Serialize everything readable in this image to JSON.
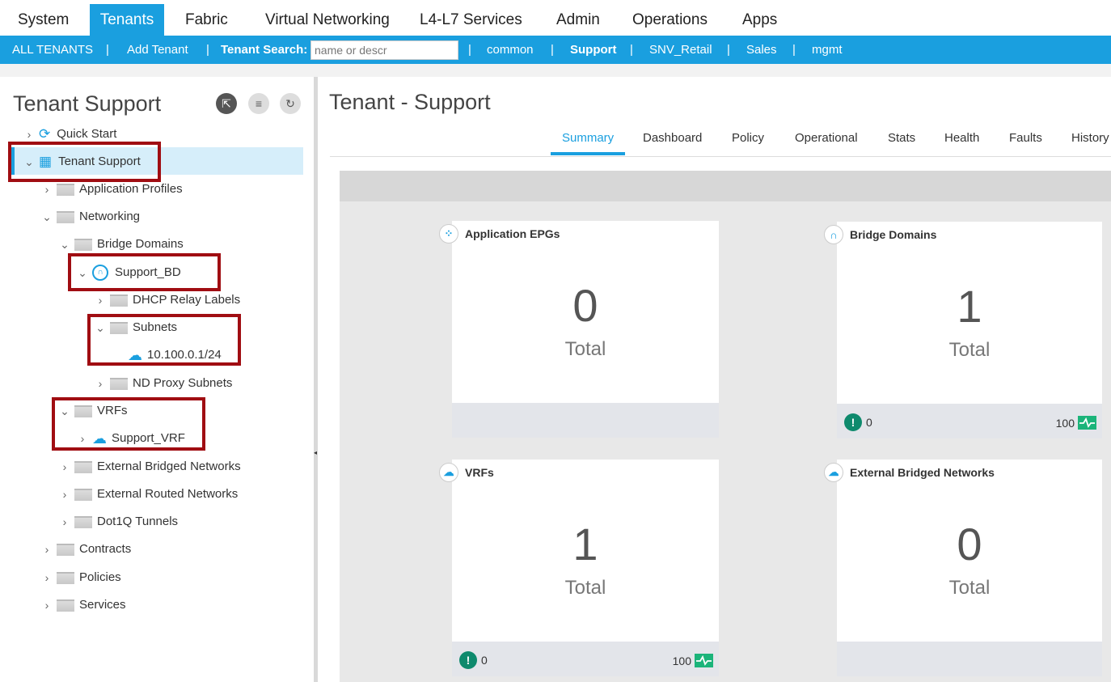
{
  "topnav": {
    "tabs": [
      "System",
      "Tenants",
      "Fabric",
      "Virtual Networking",
      "L4-L7 Services",
      "Admin",
      "Operations",
      "Apps"
    ],
    "active": "Tenants"
  },
  "subnav": {
    "all_tenants": "ALL TENANTS",
    "add_tenant": "Add Tenant",
    "search_label": "Tenant Search:",
    "search_placeholder": "name or descr",
    "tenants": [
      "common",
      "Support",
      "SNV_Retail",
      "Sales",
      "mgmt"
    ],
    "separator": "|",
    "active_tenant": "Support"
  },
  "left": {
    "title": "Tenant Support",
    "tree": [
      {
        "label": "Quick Start",
        "icon": "quick-start-icon"
      },
      {
        "label": "Tenant Support",
        "icon": "tenant-grid-icon"
      },
      {
        "label": "Application Profiles",
        "icon": "folder-icon"
      },
      {
        "label": "Networking",
        "icon": "folder-icon"
      },
      {
        "label": "Bridge Domains",
        "icon": "folder-icon"
      },
      {
        "label": "Support_BD",
        "icon": "bridge-domain-icon"
      },
      {
        "label": "DHCP Relay Labels",
        "icon": "folder-icon"
      },
      {
        "label": "Subnets",
        "icon": "folder-icon"
      },
      {
        "label": "10.100.0.1/24",
        "icon": "cloud-icon"
      },
      {
        "label": "ND Proxy Subnets",
        "icon": "folder-icon"
      },
      {
        "label": "VRFs",
        "icon": "folder-icon"
      },
      {
        "label": "Support_VRF",
        "icon": "vrf-cloud-icon"
      },
      {
        "label": "External Bridged Networks",
        "icon": "folder-icon"
      },
      {
        "label": "External Routed Networks",
        "icon": "folder-icon"
      },
      {
        "label": "Dot1Q Tunnels",
        "icon": "folder-icon"
      },
      {
        "label": "Contracts",
        "icon": "folder-icon"
      },
      {
        "label": "Policies",
        "icon": "folder-icon"
      },
      {
        "label": "Services",
        "icon": "folder-icon"
      }
    ]
  },
  "right": {
    "title": "Tenant - Support",
    "tabs": [
      "Summary",
      "Dashboard",
      "Policy",
      "Operational",
      "Stats",
      "Health",
      "Faults",
      "History"
    ],
    "active_tab": "Summary",
    "cards": [
      {
        "title": "Application EPGs",
        "value": "0",
        "unit": "Total",
        "fault": "",
        "health": ""
      },
      {
        "title": "Bridge Domains",
        "value": "1",
        "unit": "Total",
        "fault": "0",
        "health": "100"
      },
      {
        "title": "VRFs",
        "value": "1",
        "unit": "Total",
        "fault": "0",
        "health": "100"
      },
      {
        "title": "External Bridged Networks",
        "value": "0",
        "unit": "Total",
        "fault": "",
        "health": ""
      }
    ]
  },
  "colors": {
    "accent": "#1a9fdf",
    "highlight_box": "#a00d12",
    "fault_ok": "#0e8a6d",
    "health_good": "#1bb47a"
  }
}
